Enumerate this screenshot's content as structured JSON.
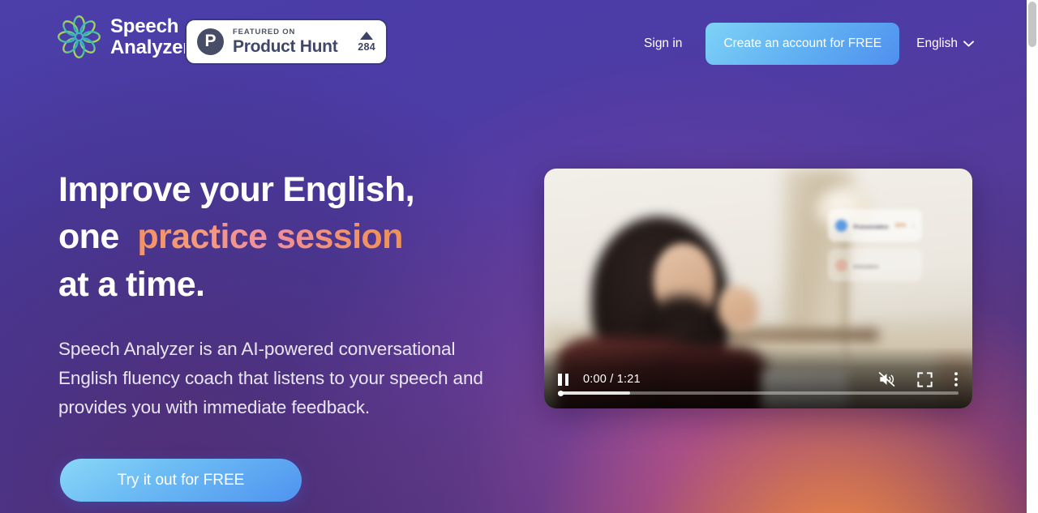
{
  "header": {
    "brand": {
      "line1": "Speech",
      "line2": "Analyzer",
      "logo_icon": "star-petals-logo-icon"
    },
    "product_hunt": {
      "logo_letter": "P",
      "featured_label": "FEATURED ON",
      "name": "Product Hunt",
      "upvote_icon": "triangle-up-icon",
      "upvotes": "284"
    },
    "sign_in_label": "Sign in",
    "cta_label": "Create an account for FREE",
    "language": {
      "label": "English",
      "chevron_icon": "chevron-down-icon"
    }
  },
  "hero": {
    "headline": {
      "line1": "Improve your English,",
      "line2_prefix": "one",
      "line2_highlight": "practice session",
      "line3": "at a time."
    },
    "paragraph": "Speech Analyzer is an AI-powered conversational English fluency coach that listens to your speech and provides you with immediate feedback.",
    "cta_label": "Try it out for FREE"
  },
  "video": {
    "pause_icon": "pause-icon",
    "time_display": "0:00 / 1:21",
    "mute_icon": "volume-muted-icon",
    "fullscreen_icon": "fullscreen-icon",
    "more_icon": "more-vertical-icon",
    "overlays": [
      {
        "title": "Pronunciation",
        "value": "65%",
        "chevron": "›",
        "icon": "info-circle-icon"
      },
      {
        "title": "Intonation",
        "value": "",
        "chevron": "",
        "icon": "wave-circle-icon"
      }
    ]
  },
  "colors": {
    "accent_blue": "#62b3f2",
    "accent_orange": "#f0914f",
    "background_purple": "#4b3fa9",
    "product_hunt_dark": "#41476a"
  }
}
